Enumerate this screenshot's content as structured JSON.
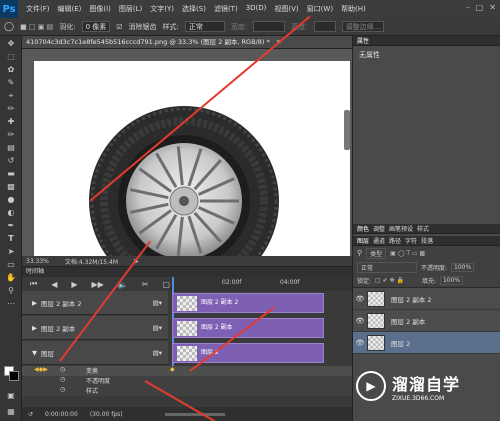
{
  "menubar": {
    "logo": "Ps",
    "items": [
      "文件(F)",
      "编辑(E)",
      "图像(I)",
      "图层(L)",
      "文字(Y)",
      "选择(S)",
      "滤镜(T)",
      "3D(D)",
      "视图(V)",
      "窗口(W)",
      "帮助(H)"
    ]
  },
  "optbar": {
    "feather_label": "羽化:",
    "feather_value": "0 像素",
    "antialias_label": "消除锯齿",
    "style_label": "样式:",
    "style_value": "正常",
    "width_label": "宽度:",
    "height_label": "高度:",
    "refine_edge": "调整边缘..."
  },
  "document": {
    "tab_title": "410704c3d3c7c1e8fe545b516cccd791.png @ 33.3% (图层 2 副本, RGB/8) *",
    "zoom": "33.33%",
    "doc_info": "文档:4.32M/15.4M"
  },
  "properties": {
    "tabs": [
      "属性"
    ],
    "no_properties": "无属性"
  },
  "layers_panel": {
    "top_tabs": [
      "颜色",
      "调整",
      "画笔预设",
      "样式"
    ],
    "tabs": [
      "图层",
      "通道",
      "路径",
      "字符",
      "段落"
    ],
    "kind_label": "类型",
    "blend_mode": "正常",
    "opacity_label": "不透明度:",
    "opacity_value": "100%",
    "lock_label": "锁定:",
    "fill_label": "填充:",
    "fill_value": "100%",
    "layers": [
      {
        "name": "图层 2 副本 2"
      },
      {
        "name": "图层 2 副本"
      },
      {
        "name": "图层 2"
      }
    ]
  },
  "timeline": {
    "panel_title": "时间轴",
    "ruler": [
      "02:00f",
      "04:00f"
    ],
    "tracks": [
      {
        "name": "图层 2 副本 2",
        "clip": "图层 2 副本 2"
      },
      {
        "name": "图层 2 副本",
        "clip": "图层 2 副本"
      },
      {
        "name": "图层",
        "clip": "图层 2"
      }
    ],
    "props": [
      "变换",
      "不透明度",
      "样式"
    ],
    "timecode": "0:00:00:00",
    "fps": "(30.00 fps)"
  },
  "watermark": {
    "brand": "溜溜自学",
    "site": "ZIXUE.3D66.COM"
  },
  "colors": {
    "accent_red": "#e53a2e",
    "clip_purple": "#7d5fb3",
    "selected_blue": "#5a6f8c"
  }
}
